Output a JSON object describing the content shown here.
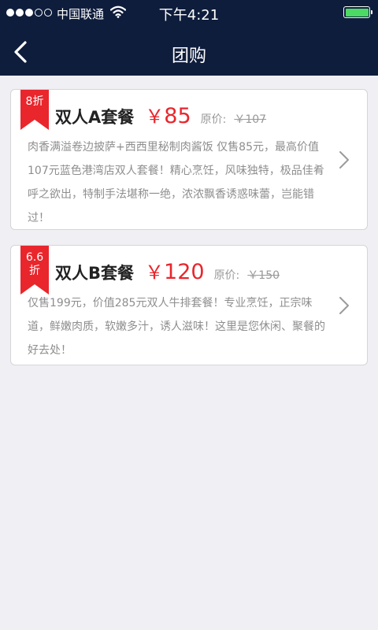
{
  "status_bar": {
    "carrier": "中国联通",
    "time": "下午4:21",
    "signal_bars_filled": 3,
    "signal_bars_total": 5,
    "battery_level": 1.0
  },
  "nav": {
    "title": "团购"
  },
  "deals": [
    {
      "discount": "8折",
      "name": "双人A套餐",
      "currency": "￥",
      "price": "85",
      "original_label": "原价:",
      "original_price": "￥107",
      "description": "肉香满溢卷边披萨+西西里秘制肉酱饭 仅售85元，最高价值107元蓝色港湾店双人套餐！精心烹饪，风味独特，极品佳肴呼之欲出，特制手法堪称一绝，浓浓飘香诱惑味蕾，岂能错过！"
    },
    {
      "discount": "6.6 折",
      "name": "双人B套餐",
      "currency": "￥",
      "price": "120",
      "original_label": "原价:",
      "original_price": "￥150",
      "description": "仅售199元，价值285元双人牛排套餐！专业烹饪，正宗味道，鲜嫩肉质，软嫩多汁，诱人滋味！这里是您休闲、聚餐的好去处！"
    }
  ],
  "colors": {
    "nav_background": "#0f1d3c",
    "accent_red": "#e9262c",
    "page_background": "#efeff4",
    "battery_green": "#4cd964"
  },
  "icons": {
    "back": "back-chevron-icon",
    "detail": "chevron-right-icon",
    "wifi": "wifi-icon",
    "battery": "battery-icon"
  }
}
